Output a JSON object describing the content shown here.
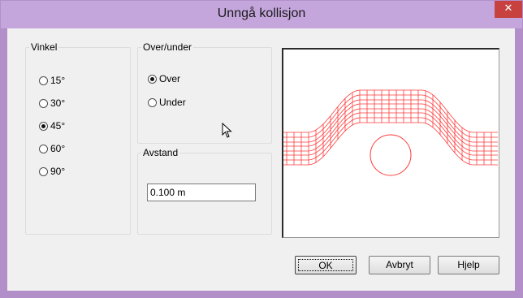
{
  "window": {
    "title": "Unngå kollisjon",
    "close_icon": "close-icon",
    "close_glyph": "✕"
  },
  "vinkel": {
    "legend": "Vinkel",
    "options": [
      {
        "label": "15°",
        "selected": false
      },
      {
        "label": "30°",
        "selected": false
      },
      {
        "label": "45°",
        "selected": true
      },
      {
        "label": "60°",
        "selected": false
      },
      {
        "label": "90°",
        "selected": false
      }
    ]
  },
  "over_under": {
    "legend": "Over/under",
    "options": [
      {
        "label": "Over",
        "selected": true
      },
      {
        "label": "Under",
        "selected": false
      }
    ]
  },
  "avstand": {
    "legend": "Avstand",
    "value": "0.100 m"
  },
  "buttons": {
    "ok": "OK",
    "cancel": "Avbryt",
    "help": "Hjelp"
  },
  "colors": {
    "titlebar": "#c4a6dd",
    "window_border": "#b28fc9",
    "close_button": "#c7413f",
    "preview_line": "#ff3b3b"
  }
}
